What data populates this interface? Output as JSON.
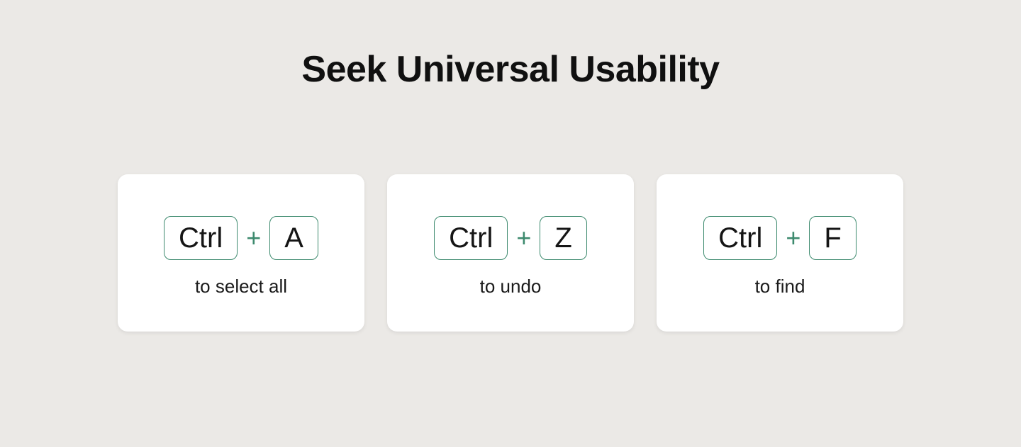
{
  "title": "Seek Universal Usability",
  "plus": "+",
  "shortcuts": [
    {
      "key1": "Ctrl",
      "key2": "A",
      "desc": "to select all"
    },
    {
      "key1": "Ctrl",
      "key2": "Z",
      "desc": "to undo"
    },
    {
      "key1": "Ctrl",
      "key2": "F",
      "desc": "to find"
    }
  ]
}
